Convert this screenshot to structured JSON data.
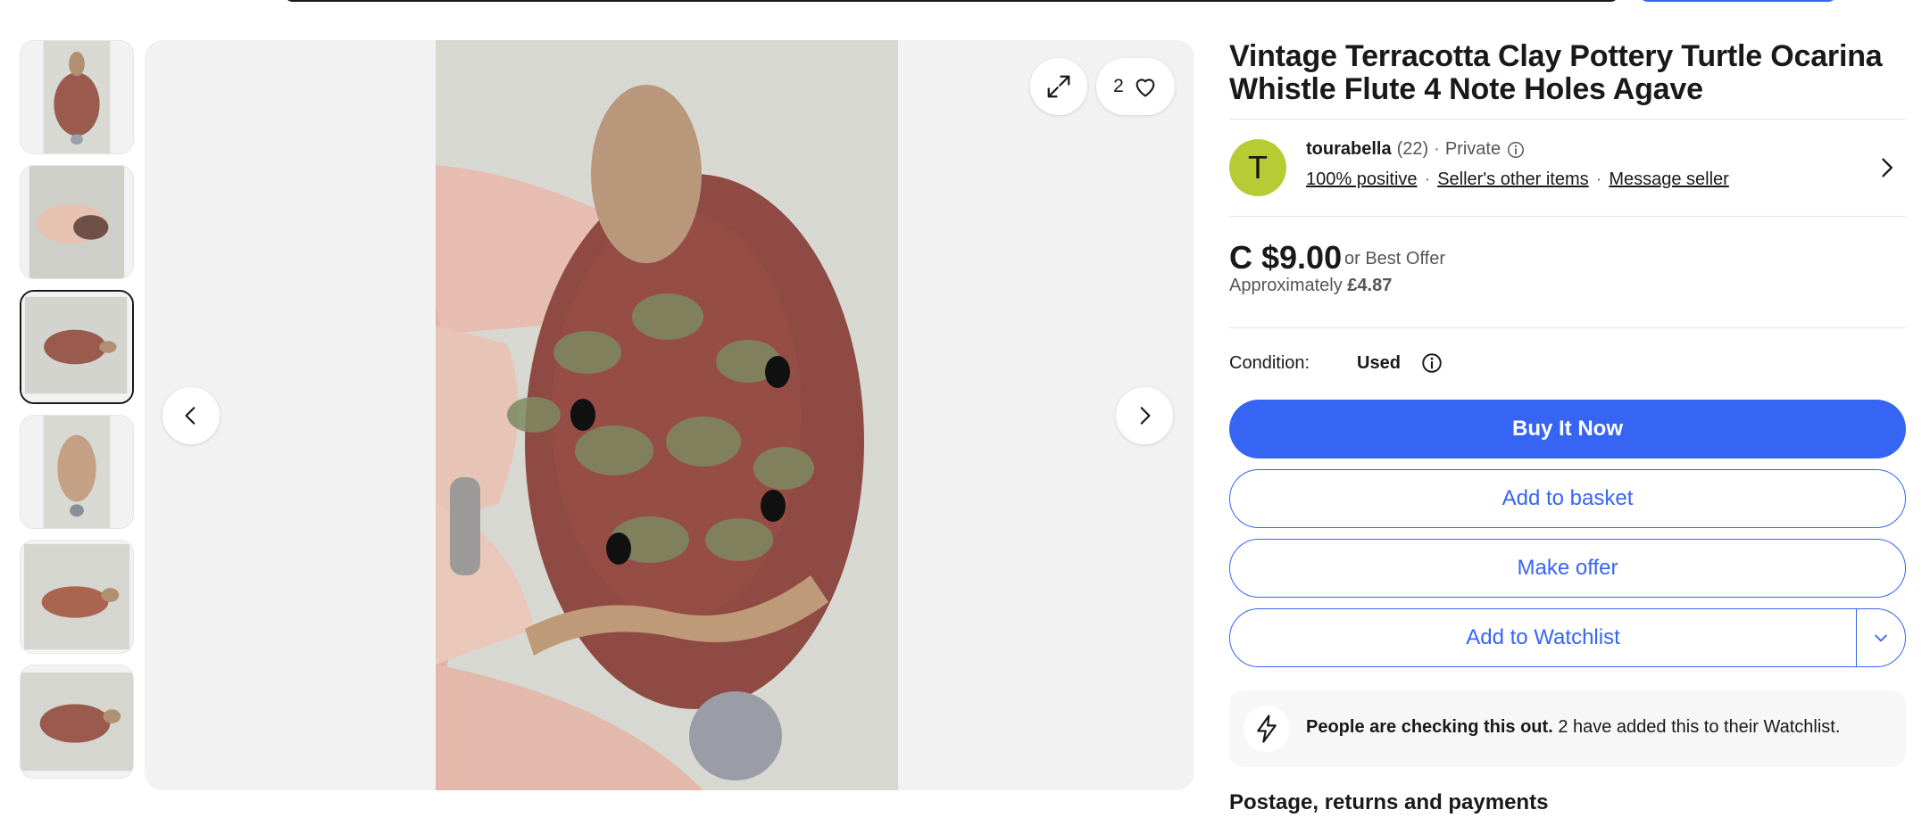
{
  "listing": {
    "title": "Vintage Terracotta Clay Pottery Turtle Ocarina Whistle Flute 4 Note Holes Agave"
  },
  "gallery": {
    "watch_count": "2",
    "thumbnail_count": 6,
    "active_thumbnail": 3
  },
  "seller": {
    "avatar_letter": "T",
    "name": "tourabella",
    "feedback_count": "(22)",
    "separator": "·",
    "account_type": "Private",
    "positive": "100% positive",
    "other_items": "Seller's other items",
    "message": "Message seller"
  },
  "price": {
    "amount": "C $9.00",
    "best_offer": "or Best Offer",
    "approx_label": "Approximately",
    "approx_value": "£4.87"
  },
  "condition": {
    "label": "Condition:",
    "value": "Used"
  },
  "actions": {
    "buy_now": "Buy It Now",
    "add_basket": "Add to basket",
    "make_offer": "Make offer",
    "watchlist": "Add to Watchlist"
  },
  "signal": {
    "bold": "People are checking this out.",
    "rest": "2 have added this to their Watchlist."
  },
  "sections": {
    "postage": "Postage, returns and payments"
  },
  "colors": {
    "primary": "#3665f3",
    "avatar": "#b5cc35",
    "text": "#191919"
  }
}
